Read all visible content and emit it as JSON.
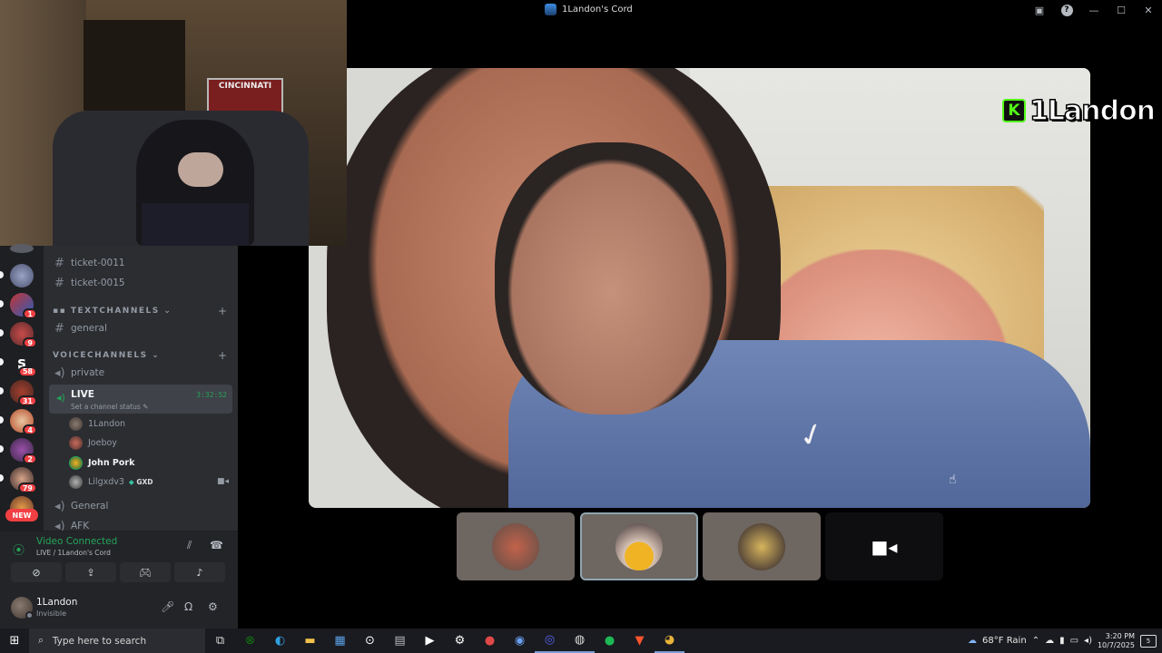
{
  "window": {
    "title": "1Landon's Cord"
  },
  "overlay": {
    "pennant_text": "CINCINNATI",
    "streamer_name": "1Landon",
    "kick_logo": "K"
  },
  "servers": [
    {
      "badge": ""
    },
    {
      "badge": "1"
    },
    {
      "badge": "9"
    },
    {
      "badge": "58"
    },
    {
      "badge": "31"
    },
    {
      "badge": "4"
    },
    {
      "badge": "2"
    },
    {
      "badge": "79"
    },
    {
      "badge": ""
    }
  ],
  "new_badge": "NEW",
  "channels": {
    "ticket_channels": [
      "ticket-0011",
      "ticket-0015"
    ],
    "text_category": "TEXTCHANNELS",
    "text_channels": [
      "general"
    ],
    "voice_category": "VOICECHANNELS",
    "voice_channels_top": [
      "private"
    ],
    "live": {
      "name": "LIVE",
      "status_placeholder": "Set a channel status",
      "timer": "3:32:52",
      "members": [
        {
          "name": "1Landon",
          "tag": ""
        },
        {
          "name": "Joeboy",
          "tag": ""
        },
        {
          "name": "John Pork",
          "tag": ""
        },
        {
          "name": "Lilgxdv3",
          "tag": "GXD"
        }
      ]
    },
    "voice_channels_bottom": [
      "General",
      "AFK"
    ]
  },
  "voice": {
    "title": "Video Connected",
    "subtitle": "LIVE / 1Landon's Cord"
  },
  "user": {
    "name": "1Landon",
    "status": "Invisible"
  },
  "taskbar": {
    "search_placeholder": "Type here to search",
    "weather": "68°F  Rain",
    "time": "3:20 PM",
    "date": "10/7/2025",
    "notifications": "5"
  },
  "colors": {
    "accent_green": "#23a55a",
    "badge_red": "#f23f43",
    "kick_green": "#53fc18"
  }
}
